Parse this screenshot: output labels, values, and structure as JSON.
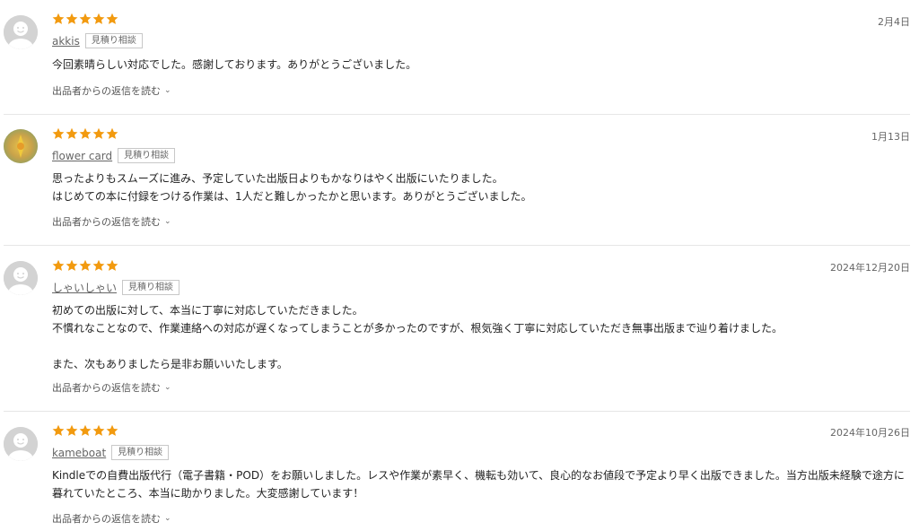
{
  "colors": {
    "star": "#f29a0f",
    "avatar_default": "#d3d3d3",
    "divider": "#e6e6e6"
  },
  "reviews": [
    {
      "rating": 5,
      "avatar": "default-avatar-icon",
      "username": "akkis",
      "badge": "見積り相談",
      "date": "2月4日",
      "body": "今回素晴らしい対応でした。感謝しております。ありがとうございました。",
      "reply_link": "出品者からの返信を読む"
    },
    {
      "rating": 5,
      "avatar": "flower-photo-avatar",
      "username": "flower card",
      "badge": "見積り相談",
      "date": "1月13日",
      "body": "思ったよりもスムーズに進み、予定していた出版日よりもかなりはやく出版にいたりました。\nはじめての本に付録をつける作業は、1人だと難しかったかと思います。ありがとうございました。",
      "reply_link": "出品者からの返信を読む"
    },
    {
      "rating": 5,
      "avatar": "default-avatar-icon",
      "username": "しゃいしゃい",
      "badge": "見積り相談",
      "date": "2024年12月20日",
      "body": "初めての出版に対して、本当に丁寧に対応していただきました。\n不慣れなことなので、作業連絡への対応が遅くなってしまうことが多かったのですが、根気強く丁寧に対応していただき無事出版まで辿り着けました。\n\nまた、次もありましたら是非お願いいたします。",
      "reply_link": "出品者からの返信を読む"
    },
    {
      "rating": 5,
      "avatar": "default-avatar-icon",
      "username": "kameboat",
      "badge": "見積り相談",
      "date": "2024年10月26日",
      "body": "Kindleでの自費出版代行（電子書籍・POD）をお願いしました。レスや作業が素早く、機転も効いて、良心的なお値段で予定より早く出版できました。当方出版未経験で途方に暮れていたところ、本当に助かりました。大変感謝しています！",
      "reply_link": "出品者からの返信を読む"
    }
  ]
}
